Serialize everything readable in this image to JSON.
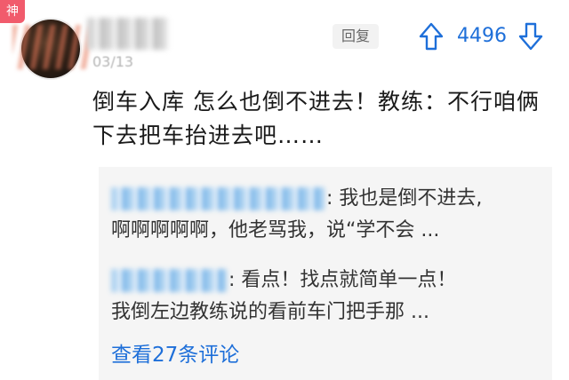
{
  "badge": {
    "label": "神"
  },
  "post": {
    "date": "03/13",
    "reply_label": "回复",
    "vote_count": "4496",
    "text": "倒车入库 怎么也倒不进去！教练：不行咱俩下去把车抬进去吧……"
  },
  "replies": [
    {
      "text_line1": ": 我也是倒不进去,",
      "text_line2": "啊啊啊啊啊，他老骂我，说“学不会 ..."
    },
    {
      "text_line1": ": 看点！找点就简单一点！",
      "text_line2": "我倒左边教练说的看前车门把手那 ..."
    }
  ],
  "see_more": "查看27条评论",
  "colors": {
    "accent": "#1e6fd9",
    "badge": "#f15b6c",
    "reply_bg": "#f5f5f5"
  },
  "icons": {
    "upvote": "arrow-up-icon",
    "downvote": "arrow-down-icon"
  }
}
